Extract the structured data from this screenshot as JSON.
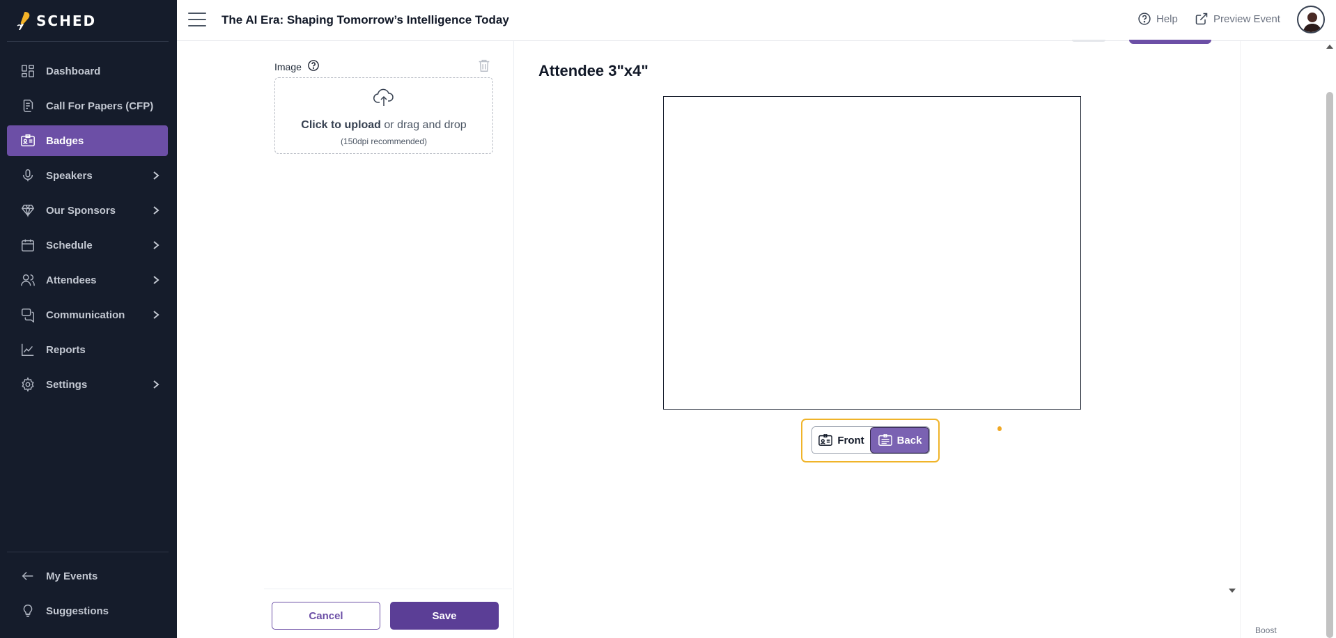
{
  "app": {
    "logo_text": "SCHED",
    "accent_color": "#6c4fa6",
    "sidebar_bg": "#151c2b"
  },
  "sidebar": {
    "items": [
      {
        "label": "Dashboard",
        "icon": "dashboard-icon",
        "has_chevron": false,
        "active": false
      },
      {
        "label": "Call For Papers (CFP)",
        "icon": "document-icon",
        "has_chevron": false,
        "active": false
      },
      {
        "label": "Badges",
        "icon": "badge-icon",
        "has_chevron": false,
        "active": true
      },
      {
        "label": "Speakers",
        "icon": "microphone-icon",
        "has_chevron": true,
        "active": false
      },
      {
        "label": "Our Sponsors",
        "icon": "diamond-icon",
        "has_chevron": true,
        "active": false
      },
      {
        "label": "Schedule",
        "icon": "calendar-icon",
        "has_chevron": true,
        "active": false
      },
      {
        "label": "Attendees",
        "icon": "users-icon",
        "has_chevron": true,
        "active": false
      },
      {
        "label": "Communication",
        "icon": "chat-icon",
        "has_chevron": true,
        "active": false
      },
      {
        "label": "Reports",
        "icon": "chart-icon",
        "has_chevron": false,
        "active": false
      },
      {
        "label": "Settings",
        "icon": "gear-icon",
        "has_chevron": true,
        "active": false
      }
    ],
    "bottom_items": [
      {
        "label": "My Events",
        "icon": "arrow-left-icon"
      },
      {
        "label": "Suggestions",
        "icon": "lightbulb-icon"
      }
    ]
  },
  "header": {
    "event_title": "The AI Era: Shaping Tomorrow’s Intelligence Today",
    "help_label": "Help",
    "preview_label": "Preview Event"
  },
  "editor": {
    "image_label": "Image",
    "upload_bold": "Click to upload",
    "upload_rest": " or drag and drop",
    "upload_hint": "(150dpi recommended)",
    "cancel_label": "Cancel",
    "save_label": "Save"
  },
  "preview": {
    "badge_title": "Attendee 3\"x4\"",
    "side_front_label": "Front",
    "side_back_label": "Back",
    "selected_side": "Back"
  },
  "footer": {
    "boost_label": "Boost"
  }
}
